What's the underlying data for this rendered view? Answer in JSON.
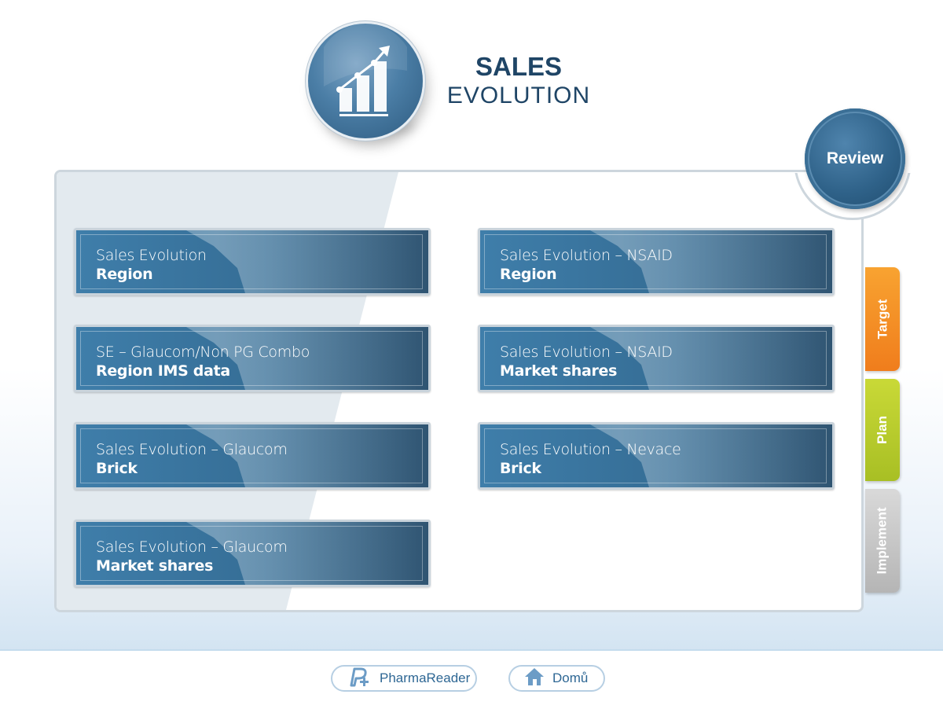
{
  "header": {
    "icon": "rising-bar-chart-icon",
    "title_line1": "SALES",
    "title_line2": "EVOLUTION"
  },
  "review": {
    "label": "Review"
  },
  "side_tabs": [
    {
      "label": "Target",
      "color": "#f28a22"
    },
    {
      "label": "Plan",
      "color": "#b6c92c"
    },
    {
      "label": "Implement",
      "color": "#c4c4c4"
    }
  ],
  "cards": [
    {
      "line1": "Sales Evolution",
      "line2": "Region"
    },
    {
      "line1": "Sales Evolution – NSAID",
      "line2": "Region"
    },
    {
      "line1": "SE – Glaucom/Non PG Combo",
      "line2": "Region IMS data"
    },
    {
      "line1": "Sales Evolution – NSAID",
      "line2": "Market shares"
    },
    {
      "line1": "Sales Evolution – Glaucom",
      "line2": "Brick"
    },
    {
      "line1": "Sales Evolution – Nevace",
      "line2": "Brick"
    },
    {
      "line1": "Sales Evolution – Glaucom",
      "line2": "Market shares"
    }
  ],
  "footer": {
    "pharmareader": {
      "label": "PharmaReader",
      "icon": "pharmareader-logo-icon"
    },
    "home": {
      "label": "Domů",
      "icon": "home-icon"
    }
  },
  "colors": {
    "card_blue": "#356d95",
    "title_navy": "#1f4566",
    "review_blue": "#2f6289"
  }
}
